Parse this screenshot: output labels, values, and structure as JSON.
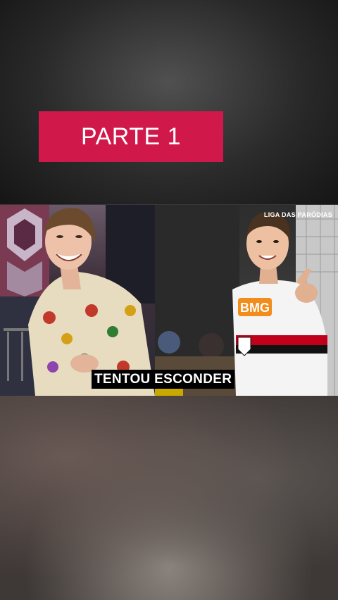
{
  "banner": {
    "label": "PARTE 1",
    "color": "#d0184a"
  },
  "watermark": "LIGA DAS PARÓDIAS",
  "caption": "TENTOU ESCONDER",
  "images": {
    "left": "singer-photo",
    "right": "football-player-photo"
  }
}
